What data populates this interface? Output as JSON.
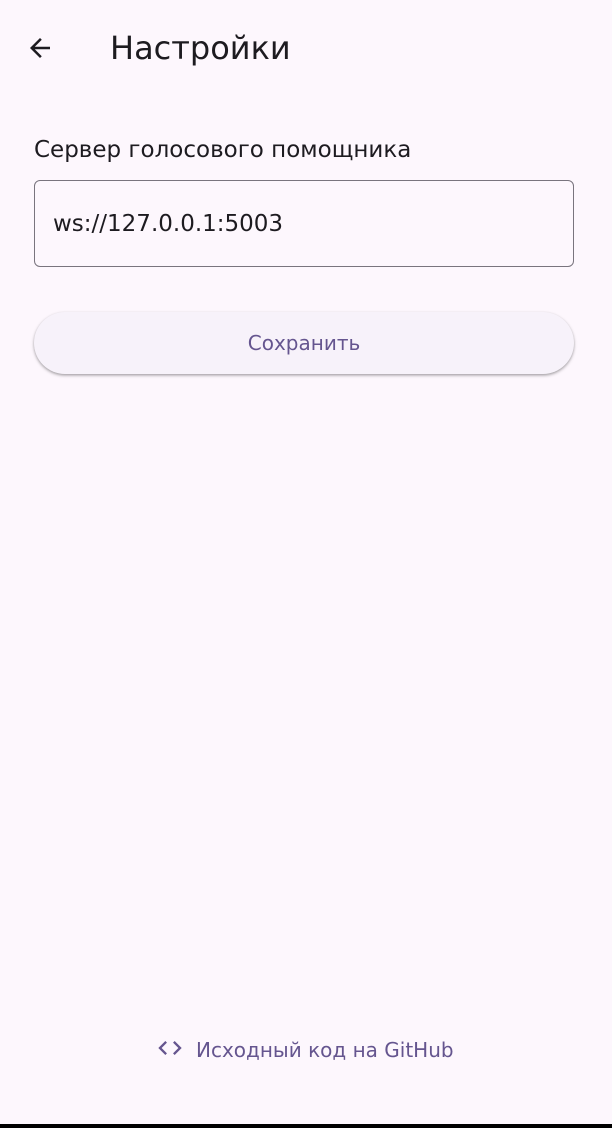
{
  "app_bar": {
    "back_icon": "arrow-back-icon",
    "title": "Настройки"
  },
  "settings": {
    "server_label": "Сервер голосового помощника",
    "server_value": "ws://127.0.0.1:5003",
    "save_label": "Сохранить"
  },
  "footer": {
    "github_icon": "code-icon",
    "github_label": "Исходный код на GitHub"
  },
  "colors": {
    "background": "#fdf7fd",
    "primary": "#65558f",
    "on_surface": "#1d1b20",
    "outline": "#79747e",
    "button_surface": "#f7f2fa"
  }
}
